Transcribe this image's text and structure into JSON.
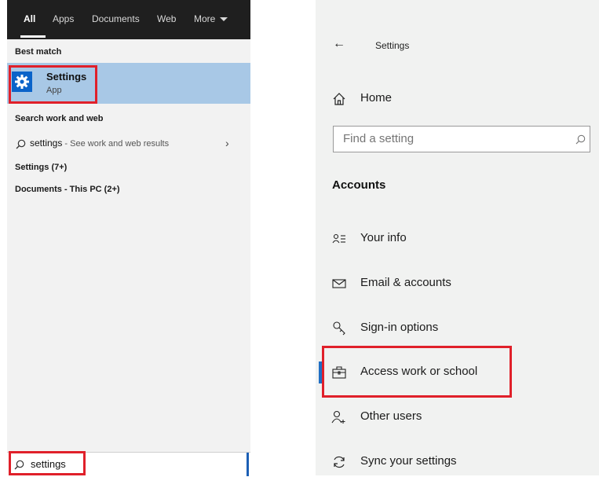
{
  "search": {
    "tabs": [
      {
        "label": "All"
      },
      {
        "label": "Apps"
      },
      {
        "label": "Documents"
      },
      {
        "label": "Web"
      },
      {
        "label": "More"
      }
    ],
    "best_match_heading": "Best match",
    "best_match": {
      "title": "Settings",
      "subtitle": "App"
    },
    "web_heading": "Search work and web",
    "web_result": {
      "query": "settings",
      "hint": " - See work and web results"
    },
    "settings_group": "Settings (7+)",
    "documents_group": "Documents - This PC (2+)",
    "input_value": "settings"
  },
  "settings": {
    "title": "Settings",
    "home_label": "Home",
    "find_placeholder": "Find a setting",
    "section": "Accounts",
    "items": [
      {
        "label": "Your info"
      },
      {
        "label": "Email & accounts"
      },
      {
        "label": "Sign-in options"
      },
      {
        "label": "Access work or school"
      },
      {
        "label": "Other users"
      },
      {
        "label": "Sync your settings"
      }
    ],
    "selected_item": "Access work or school"
  },
  "colors": {
    "highlight_box": "#e0202a",
    "selection_bg": "#a8c8e6",
    "accent": "#0a63c9"
  }
}
